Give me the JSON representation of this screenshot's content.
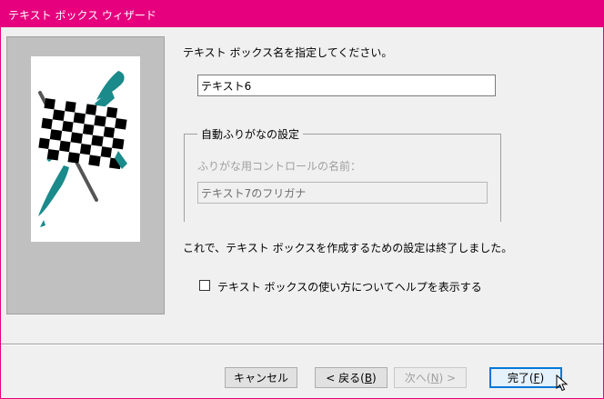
{
  "window": {
    "title": "テキスト ボックス ウィザード"
  },
  "main": {
    "name_prompt": "テキスト ボックス名を指定してください。",
    "name_value": "テキスト6",
    "group_title": "自動ふりがなの設定",
    "furigana_label": "ふりがな用コントロールの名前：",
    "furigana_value": "テキスト7のフリガナ",
    "finish_message": "これで、テキスト ボックスを作成するための設定は終了しました。",
    "help_checkbox_label": "テキスト ボックスの使い方についてヘルプを表示する",
    "help_checkbox_checked": false
  },
  "buttons": {
    "cancel": "キャンセル",
    "back_prefix": "< 戻る(",
    "back_key": "B",
    "back_suffix": ")",
    "next_prefix": "次へ(",
    "next_key": "N",
    "next_suffix": ") >",
    "finish_prefix": "完了(",
    "finish_key": "F",
    "finish_suffix": ")"
  },
  "colors": {
    "titlebar": "#e6007e",
    "flag_swoosh": "#1a8a8a",
    "window_bg": "#f0f0f0"
  },
  "icons": {
    "wizard_image": "checkered-flag-icon",
    "pointer": "mouse-cursor-icon"
  }
}
